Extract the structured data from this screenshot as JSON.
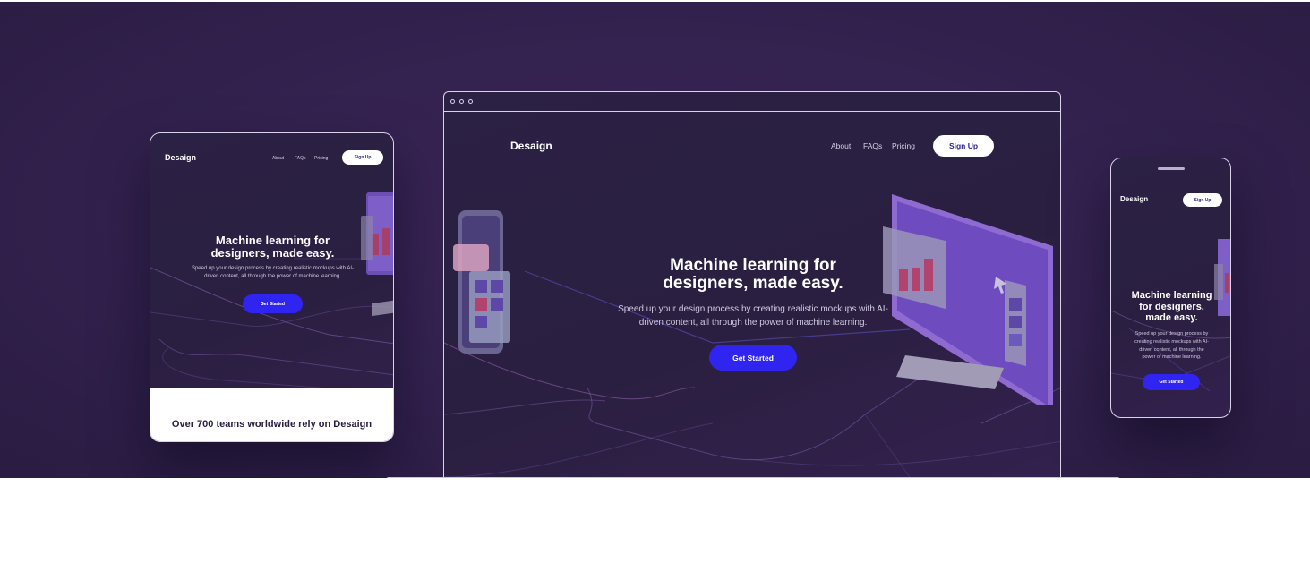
{
  "brand": "Desaign",
  "nav": {
    "about": "About",
    "faqs": "FAQs",
    "pricing": "Pricing",
    "signup": "Sign Up"
  },
  "hero": {
    "title_line1": "Machine learning for",
    "title_line2": "designers, made easy.",
    "subtitle_line1": "Speed up your design process by creating realistic mockups with AI-",
    "subtitle_line2": "driven content, all through the power of machine learning.",
    "cta": "Get Started"
  },
  "phone_hero": {
    "title_line1": "Machine learning",
    "title_line2": "for designers,",
    "title_line3": "made easy.",
    "subtitle_line1": "Speed up your design process by",
    "subtitle_line2": "creating realistic mockups with AI-",
    "subtitle_line3": "driven content, all through the",
    "subtitle_line4": "power of machine learning."
  },
  "social_proof": "Over 700 teams worldwide rely on Desaign",
  "colors": {
    "background": "#352251",
    "accent": "#3024f0",
    "device_bg": "#2a1f40",
    "white": "#ffffff"
  }
}
